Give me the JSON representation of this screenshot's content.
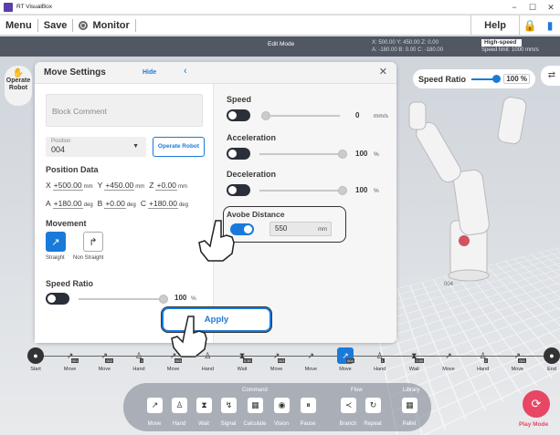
{
  "window": {
    "title": "RT VisualBox"
  },
  "menu": {
    "menu_label": "Menu",
    "save_label": "Save",
    "monitor_label": "Monitor",
    "help_label": "Help"
  },
  "status": {
    "mode": "Edit Mode",
    "coord_line1": "X:  500.00 Y:  450.00 Z:    0.00",
    "coord_line2": "A:  -180.00 B:    0.00 C:  -180.00",
    "speed_mode": "High-speed",
    "speed_limit": "Speed limit:   1000 mm/s"
  },
  "side": {
    "operate_robot_label": "Operate Robot"
  },
  "speed_ratio_top": {
    "label": "Speed Ratio",
    "value": "100 %"
  },
  "panel": {
    "title": "Move Settings",
    "hide_label": "Hide",
    "block_comment_placeholder": "Block Comment",
    "position_label": "Position",
    "position_value": "004",
    "operate_robot_button": "Operate Robot",
    "position_data_title": "Position Data",
    "pos": {
      "x_label": "X",
      "x_value": "+500.00",
      "x_unit": "mm",
      "y_label": "Y",
      "y_value": "+450.00",
      "y_unit": "mm",
      "z_label": "Z",
      "z_value": "+0.00",
      "z_unit": "mm",
      "a_label": "A",
      "a_value": "+180.00",
      "a_unit": "deg",
      "b_label": "B",
      "b_value": "+0.00",
      "b_unit": "deg",
      "c_label": "C",
      "c_value": "+180.00",
      "c_unit": "deg"
    },
    "movement_title": "Movement",
    "movement_straight": "Straight",
    "movement_non_straight": "Non Straight",
    "speed_ratio_title": "Speed Ratio",
    "speed_ratio_value": "100",
    "speed_ratio_unit": "%",
    "speed_title": "Speed",
    "speed_value": "0",
    "speed_unit": "mm/s",
    "acceleration_title": "Acceleration",
    "acceleration_value": "100",
    "acceleration_unit": "%",
    "deceleration_title": "Deceleration",
    "deceleration_value": "100",
    "deceleration_unit": "%",
    "avobe_title": "Avobe Distance",
    "avobe_value": "550",
    "avobe_unit": "mm",
    "apply_label": "Apply"
  },
  "flow_nodes": [
    {
      "label": "Start",
      "badge": ""
    },
    {
      "label": "Move",
      "badge": "001"
    },
    {
      "label": "Move",
      "badge": "002"
    },
    {
      "label": "Hand",
      "badge": "1"
    },
    {
      "label": "Move",
      "badge": "003"
    },
    {
      "label": "Hand",
      "badge": ""
    },
    {
      "label": "Wait",
      "badge": "0.50"
    },
    {
      "label": "Move",
      "badge": "003"
    },
    {
      "label": "Move",
      "badge": ""
    },
    {
      "label": "Move",
      "badge": "004"
    },
    {
      "label": "Hand",
      "badge": "1"
    },
    {
      "label": "Wait",
      "badge": "0.50"
    },
    {
      "label": "Move",
      "badge": ""
    },
    {
      "label": "Hand",
      "badge": "2"
    },
    {
      "label": "Move",
      "badge": "001"
    },
    {
      "label": "End",
      "badge": ""
    }
  ],
  "cmd_groups": {
    "command": "Command",
    "flow": "Flow",
    "library": "Library"
  },
  "cmd_buttons": [
    "Move",
    "Hand",
    "Wait",
    "Signal",
    "Calculate",
    "Vision",
    "Pause",
    "Branch",
    "Repeat",
    "Pallet"
  ],
  "scene": {
    "marker_label": "004"
  },
  "play": {
    "label": "Play Mode"
  },
  "colors": {
    "accent": "#1a7ad9",
    "play": "#e84664",
    "toolbar": "#3c424e"
  }
}
